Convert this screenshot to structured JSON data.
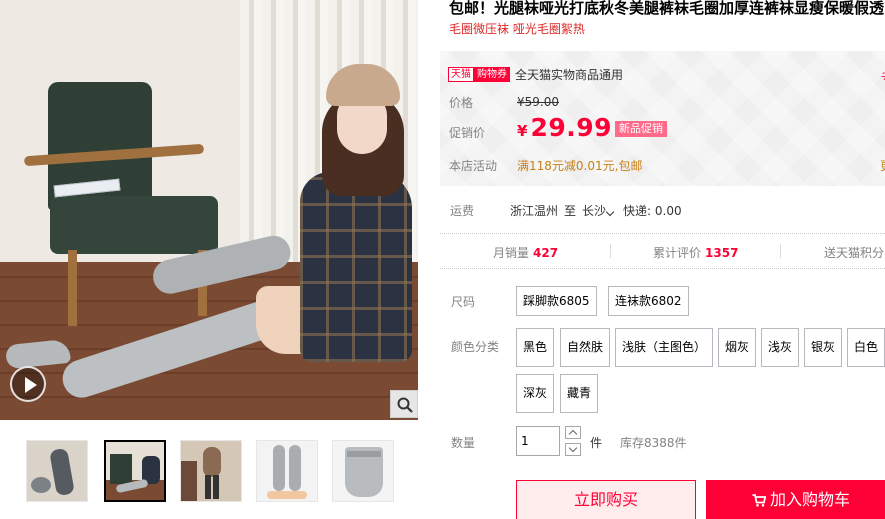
{
  "product": {
    "title": "包邮！光腿袜哑光打底秋冬美腿裤袜毛圈加厚连裤袜显瘦保暖假透",
    "subtitle": "毛圈微压袜 哑光毛圈絮热"
  },
  "price_panel": {
    "tag_tmall": "天猫",
    "tag_coupon": "购物券",
    "coupon_text": "全天猫实物商品通用",
    "coupon_more": "去",
    "price_label": "价格",
    "original_price": "¥59.00",
    "promo_label": "促销价",
    "currency": "¥",
    "promo_price": "29.99",
    "promo_badge": "新品促销",
    "activity_label": "本店活动",
    "activity_text": "满118元减0.01元,包邮",
    "more_link": "更"
  },
  "shipping": {
    "label": "运费",
    "from": "浙江温州",
    "to_word": "至",
    "city": "长沙",
    "method": "快递: 0.00"
  },
  "stats": [
    {
      "label": "月销量",
      "value": "427"
    },
    {
      "label": "累计评价",
      "value": "1357"
    },
    {
      "label": "送天猫积分",
      "value": ""
    }
  ],
  "sku": {
    "size_label": "尺码",
    "sizes": [
      "踩脚款6805",
      "连袜款6802"
    ],
    "color_label": "颜色分类",
    "colors": [
      "黑色",
      "自然肤",
      "浅肤（主图色）",
      "烟灰",
      "浅灰",
      "银灰",
      "白色",
      "深灰",
      "藏青"
    ]
  },
  "quantity": {
    "label": "数量",
    "value": "1",
    "unit": "件",
    "stock": "库存8388件"
  },
  "actions": {
    "buy_now": "立即购买",
    "add_to_cart": "加入购物车"
  },
  "colors": {
    "brand_red": "#ff0036",
    "badge_pink": "#ff6a8a",
    "activity_orange": "#c6801a"
  },
  "icons": {
    "play": "play-icon",
    "zoom": "magnifier-icon",
    "cart": "cart-icon"
  }
}
